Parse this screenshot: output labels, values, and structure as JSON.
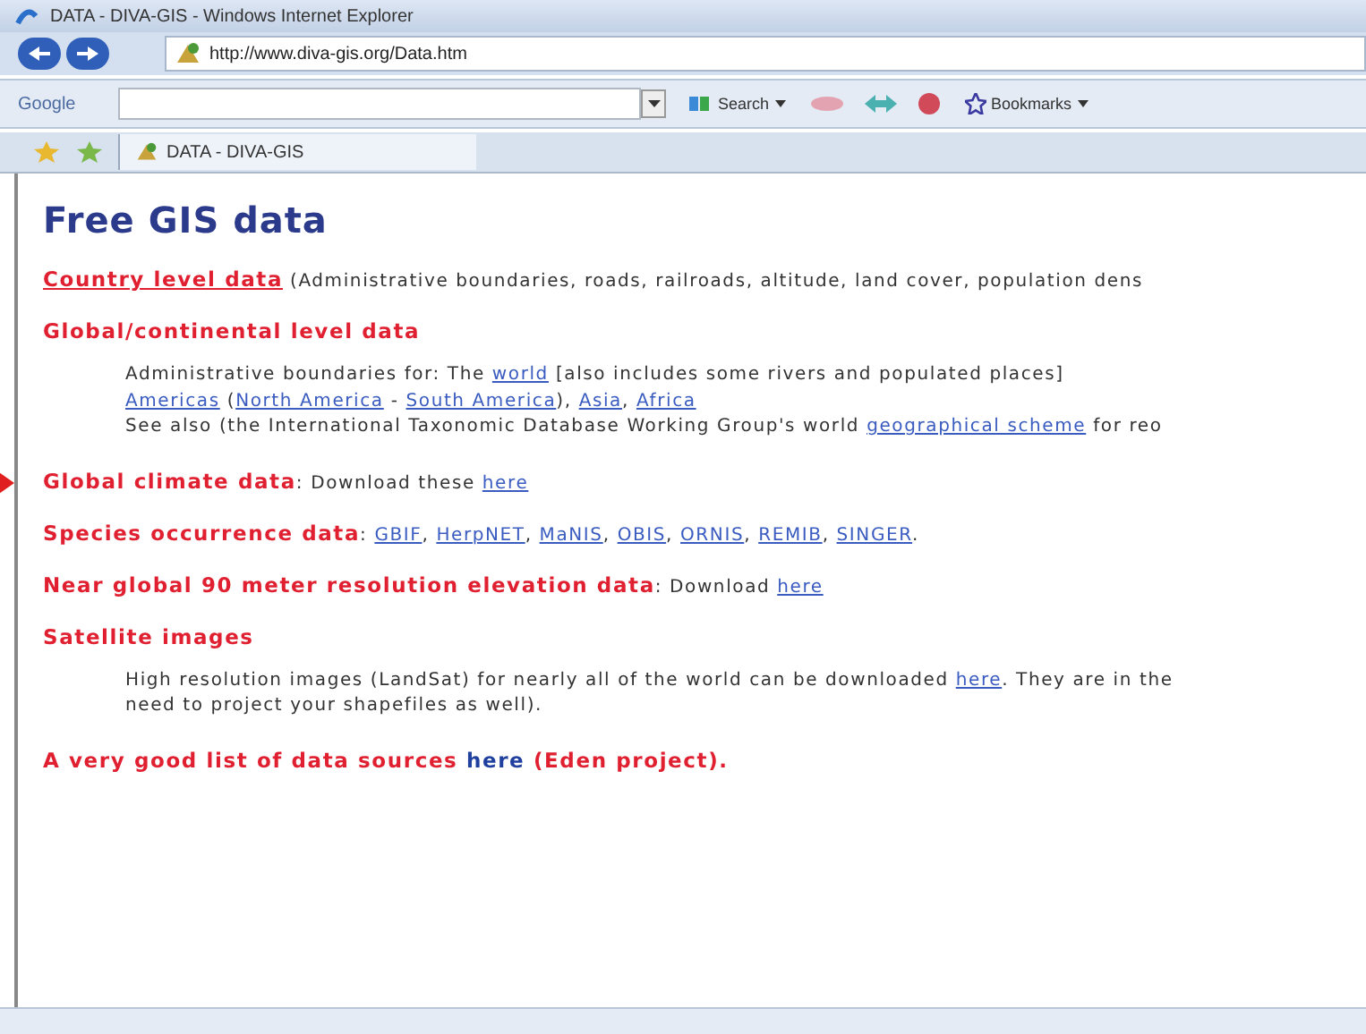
{
  "window": {
    "title": "DATA - DIVA-GIS - Windows Internet Explorer"
  },
  "address_bar": {
    "url": "http://www.diva-gis.org/Data.htm"
  },
  "google_toolbar": {
    "logo": "Google",
    "search_label": "Search",
    "bookmarks_label": "Bookmarks"
  },
  "tabs": [
    {
      "label": "DATA - DIVA-GIS",
      "selected": true
    }
  ],
  "page": {
    "heading": "Free GIS data",
    "blocks": [
      {
        "kind": "heading",
        "pointer": false,
        "segments": [
          {
            "kind": "red_link",
            "text": "Country level data"
          },
          {
            "kind": "plain",
            "text": " (Administrative boundaries, roads, railroads, altitude, land cover, population dens"
          }
        ]
      },
      {
        "kind": "heading",
        "pointer": false,
        "segments": [
          {
            "kind": "red",
            "text": "Global/continental level data"
          }
        ]
      },
      {
        "kind": "indent",
        "lines": [
          [
            {
              "kind": "plain",
              "text": "Administrative boundaries for: The "
            },
            {
              "kind": "link",
              "text": "world"
            },
            {
              "kind": "plain",
              "text": " [also includes some rivers and populated places]"
            }
          ],
          [
            {
              "kind": "link",
              "text": "Americas"
            },
            {
              "kind": "plain",
              "text": " ("
            },
            {
              "kind": "link",
              "text": "North America"
            },
            {
              "kind": "plain",
              "text": " - "
            },
            {
              "kind": "link",
              "text": "South America"
            },
            {
              "kind": "plain",
              "text": "), "
            },
            {
              "kind": "link",
              "text": "Asia"
            },
            {
              "kind": "plain",
              "text": ", "
            },
            {
              "kind": "link",
              "text": "Africa"
            }
          ],
          [
            {
              "kind": "plain",
              "text": "See also (the International Taxonomic Database Working Group's world "
            },
            {
              "kind": "link",
              "text": "geographical scheme"
            },
            {
              "kind": "plain",
              "text": " for reo"
            }
          ]
        ]
      },
      {
        "kind": "heading",
        "pointer": true,
        "segments": [
          {
            "kind": "red",
            "text": "Global climate data"
          },
          {
            "kind": "plain",
            "text": ": Download these "
          },
          {
            "kind": "link",
            "text": "here"
          }
        ]
      },
      {
        "kind": "heading",
        "pointer": false,
        "segments": [
          {
            "kind": "red",
            "text": "Species occurrence data"
          },
          {
            "kind": "plain",
            "text": ":  "
          },
          {
            "kind": "link",
            "text": "GBIF"
          },
          {
            "kind": "plain",
            "text": ", "
          },
          {
            "kind": "link",
            "text": "HerpNET"
          },
          {
            "kind": "plain",
            "text": ", "
          },
          {
            "kind": "link",
            "text": "MaNIS"
          },
          {
            "kind": "plain",
            "text": ", "
          },
          {
            "kind": "link",
            "text": "OBIS"
          },
          {
            "kind": "plain",
            "text": ", "
          },
          {
            "kind": "link",
            "text": "ORNIS"
          },
          {
            "kind": "plain",
            "text": ", "
          },
          {
            "kind": "link",
            "text": "REMIB"
          },
          {
            "kind": "plain",
            "text": ", "
          },
          {
            "kind": "link",
            "text": "SINGER"
          },
          {
            "kind": "plain",
            "text": "."
          }
        ]
      },
      {
        "kind": "heading",
        "pointer": false,
        "segments": [
          {
            "kind": "red",
            "text": "Near global 90 meter resolution elevation data"
          },
          {
            "kind": "plain",
            "text": ": Download "
          },
          {
            "kind": "link",
            "text": "here"
          }
        ]
      },
      {
        "kind": "heading",
        "pointer": false,
        "segments": [
          {
            "kind": "red",
            "text": "Satellite images"
          }
        ]
      },
      {
        "kind": "indent",
        "lines": [
          [
            {
              "kind": "plain",
              "text": "High resolution images (LandSat) for nearly all of the world can be downloaded "
            },
            {
              "kind": "link",
              "text": "here"
            },
            {
              "kind": "plain",
              "text": ". They are in the"
            }
          ],
          [
            {
              "kind": "plain",
              "text": "need to project your shapefiles as well)."
            }
          ]
        ]
      },
      {
        "kind": "heading",
        "pointer": false,
        "segments": [
          {
            "kind": "red",
            "text": "A very good list of data sources "
          },
          {
            "kind": "big_link",
            "text": "here"
          },
          {
            "kind": "red",
            "text": " (Eden project)."
          }
        ]
      }
    ]
  }
}
